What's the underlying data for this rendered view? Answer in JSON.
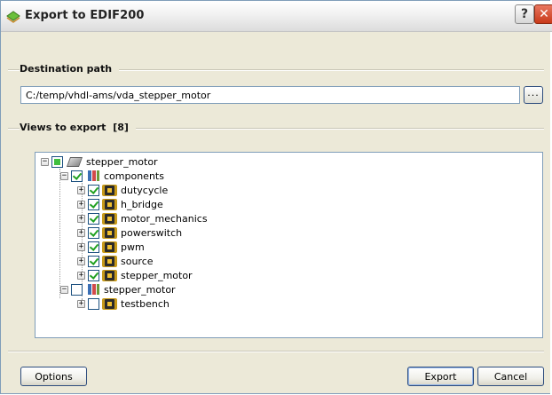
{
  "window": {
    "title": "Export to EDIF200",
    "help_label": "?",
    "close_label": "✕"
  },
  "destination": {
    "group_label": "Destination path",
    "path_value": "C:/temp/vhdl-ams/vda_stepper_motor",
    "browse_label": "..."
  },
  "views": {
    "group_label": "Views to export",
    "count_label": "[8]",
    "tree": [
      {
        "label": "stepper_motor",
        "level": 0,
        "expander": "−",
        "check": "partial",
        "icon": "design-icon"
      },
      {
        "label": "components",
        "level": 1,
        "expander": "−",
        "check": "checked",
        "icon": "library-icon"
      },
      {
        "label": "dutycycle",
        "level": 2,
        "expander": "+",
        "check": "checked",
        "icon": "component-chip-icon"
      },
      {
        "label": "h_bridge",
        "level": 2,
        "expander": "+",
        "check": "checked",
        "icon": "component-chip-icon"
      },
      {
        "label": "motor_mechanics",
        "level": 2,
        "expander": "+",
        "check": "checked",
        "icon": "component-chip-icon"
      },
      {
        "label": "powerswitch",
        "level": 2,
        "expander": "+",
        "check": "checked",
        "icon": "component-chip-icon"
      },
      {
        "label": "pwm",
        "level": 2,
        "expander": "+",
        "check": "checked",
        "icon": "component-chip-icon"
      },
      {
        "label": "source",
        "level": 2,
        "expander": "+",
        "check": "checked",
        "icon": "component-chip-icon"
      },
      {
        "label": "stepper_motor",
        "level": 2,
        "expander": "+",
        "check": "checked",
        "icon": "component-chip-icon"
      },
      {
        "label": "stepper_motor",
        "level": 1,
        "expander": "−",
        "check": "unchecked",
        "icon": "library-icon"
      },
      {
        "label": "testbench",
        "level": 2,
        "expander": "+",
        "check": "unchecked",
        "icon": "component-chip-icon"
      }
    ]
  },
  "buttons": {
    "options_label": "Options",
    "export_label": "Export",
    "cancel_label": "Cancel"
  },
  "colors": {
    "dialog_bg": "#ece9d8",
    "border": "#7f9db9",
    "check_green": "#21a121"
  }
}
